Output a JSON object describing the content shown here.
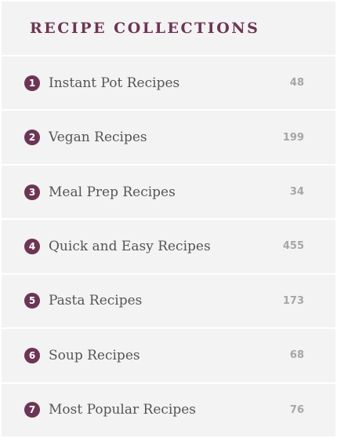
{
  "header": {
    "title": "RECIPE COLLECTIONS"
  },
  "colors": {
    "accent": "#6d3555",
    "row_background": "#f3f3f3",
    "count_text": "#a6a6a6",
    "label_text": "#555555"
  },
  "collections": [
    {
      "number": "1",
      "label": "Instant Pot Recipes",
      "count": "48"
    },
    {
      "number": "2",
      "label": "Vegan Recipes",
      "count": "199"
    },
    {
      "number": "3",
      "label": "Meal Prep Recipes",
      "count": "34"
    },
    {
      "number": "4",
      "label": "Quick and Easy Recipes",
      "count": "455"
    },
    {
      "number": "5",
      "label": "Pasta Recipes",
      "count": "173"
    },
    {
      "number": "6",
      "label": "Soup Recipes",
      "count": "68"
    },
    {
      "number": "7",
      "label": "Most Popular Recipes",
      "count": "76"
    }
  ]
}
